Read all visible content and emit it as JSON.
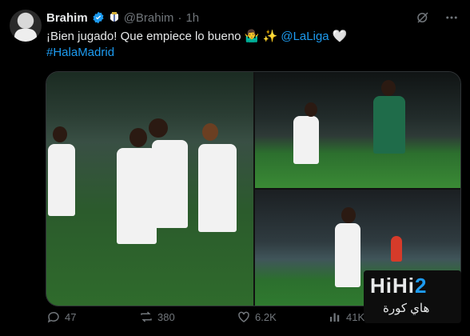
{
  "post": {
    "display_name": "Brahim",
    "handle": "@Brahim",
    "separator": "·",
    "time": "1h",
    "text_main": "¡Bien jugado! Que empiece lo bueno 🤷‍♂️ ✨ ",
    "mention": "@LaLiga",
    "heart": "🤍",
    "hashtag": "#HalaMadrid"
  },
  "metrics": {
    "replies": "47",
    "reposts": "380",
    "likes": "6.2K",
    "views": "41K"
  },
  "watermark": {
    "main_prefix": "HiHi",
    "main_suffix": "2",
    "sub": "هاي كورة"
  },
  "icons": {
    "verified": "verified-badge-icon",
    "club": "club-crest-icon",
    "grok": "grok-icon",
    "more": "more-icon",
    "reply": "reply-icon",
    "repost": "repost-icon",
    "like": "like-icon",
    "views": "views-icon"
  },
  "colors": {
    "background": "#000000",
    "text": "#e7e9ea",
    "muted": "#71767b",
    "link": "#1d9bf0"
  }
}
